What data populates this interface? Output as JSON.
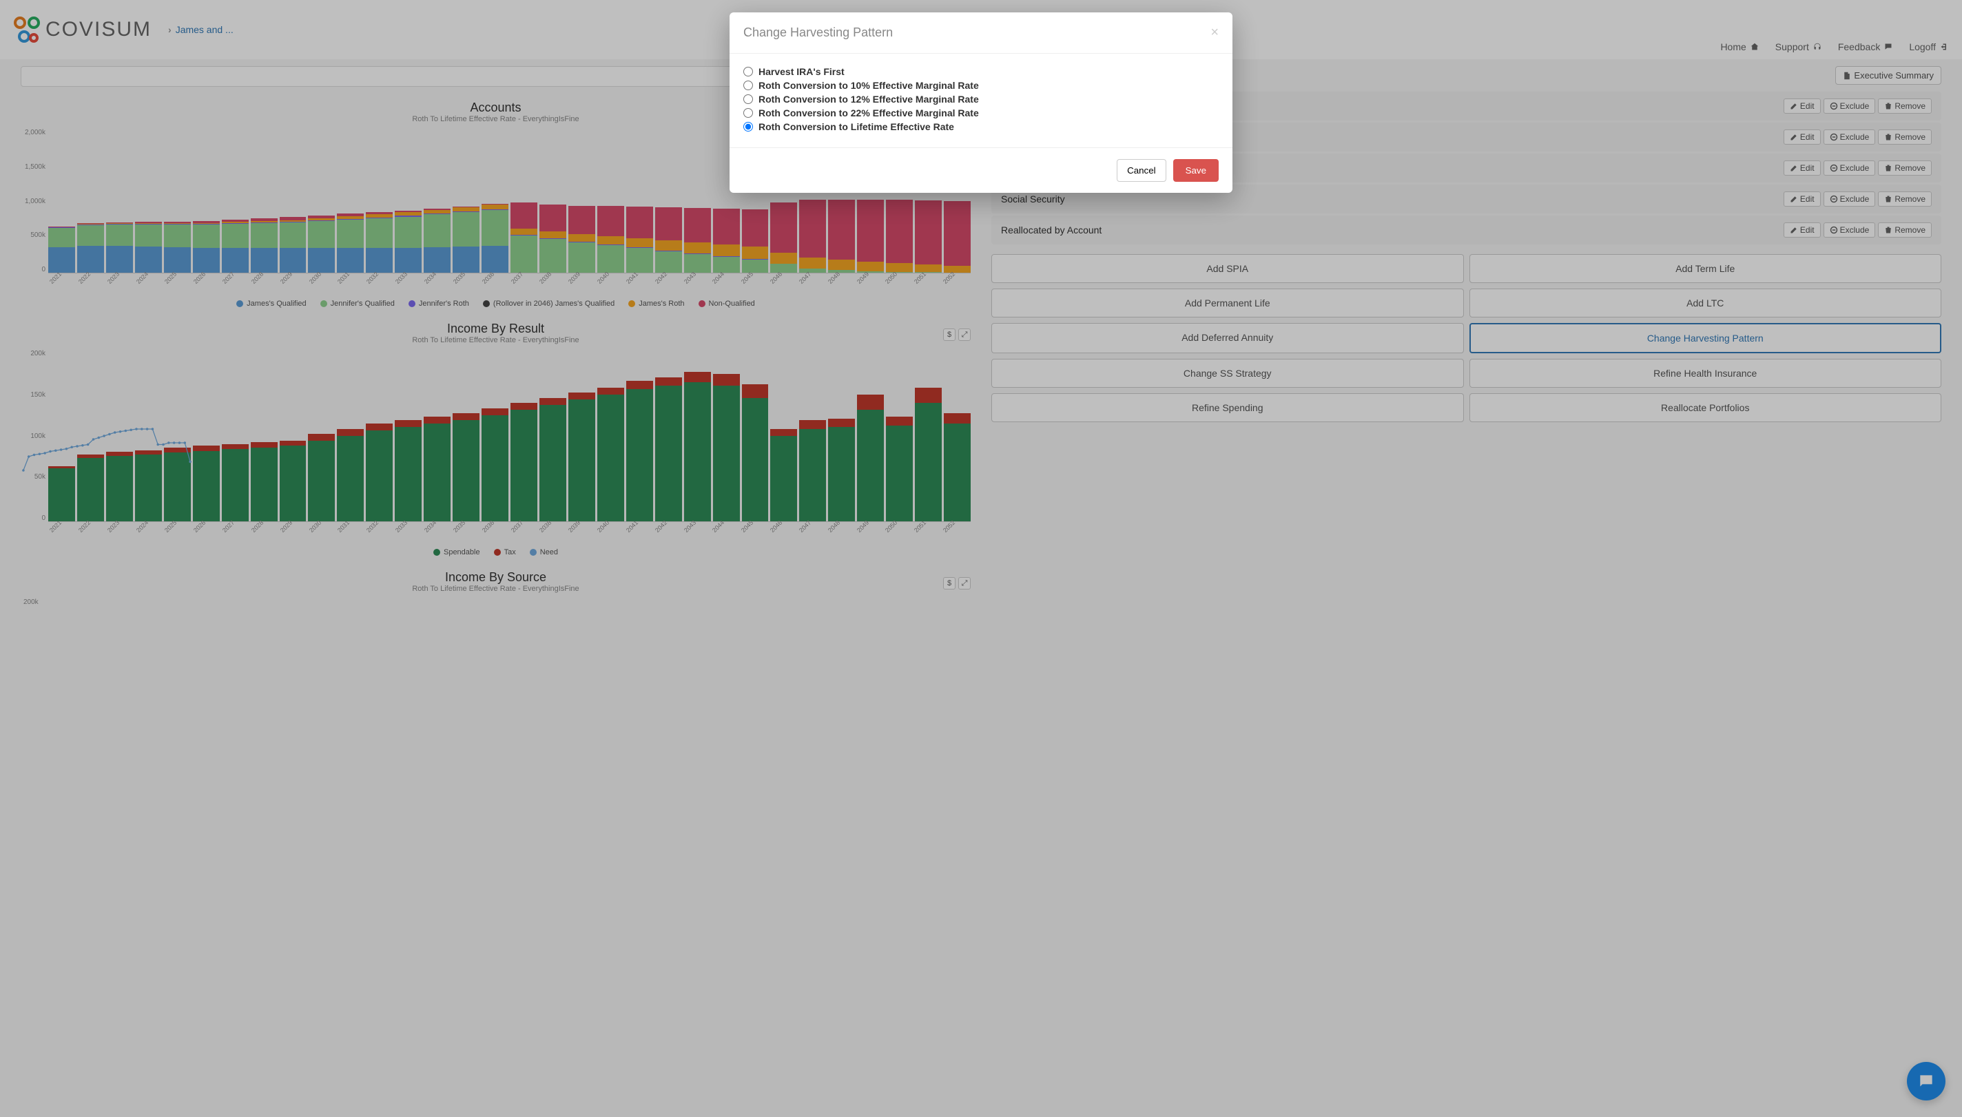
{
  "logo_text": "COVISUM",
  "breadcrumb": "James and ...",
  "nav": {
    "home": "Home",
    "support": "Support",
    "feedback": "Feedback",
    "logoff": "Logoff"
  },
  "exec_summary": "Executive Summary",
  "item_rows": [
    {
      "label": ""
    },
    {
      "label": ""
    },
    {
      "label": ""
    },
    {
      "label": "Social Security"
    },
    {
      "label": "Reallocated by Account"
    }
  ],
  "row_actions": {
    "edit": "Edit",
    "exclude": "Exclude",
    "remove": "Remove"
  },
  "buttons": {
    "add_spia": "Add SPIA",
    "add_term": "Add Term Life",
    "add_perm": "Add Permanent Life",
    "add_ltc": "Add LTC",
    "add_def": "Add Deferred Annuity",
    "change_harvest": "Change Harvesting Pattern",
    "change_ss": "Change SS Strategy",
    "refine_health": "Refine Health Insurance",
    "refine_spend": "Refine Spending",
    "realloc": "Reallocate Portfolios"
  },
  "modal": {
    "title": "Change Harvesting Pattern",
    "options": [
      "Harvest IRA's First",
      "Roth Conversion to 10% Effective Marginal Rate",
      "Roth Conversion to 12% Effective Marginal Rate",
      "Roth Conversion to 22% Effective Marginal Rate",
      "Roth Conversion to Lifetime Effective Rate"
    ],
    "selected": 4,
    "cancel": "Cancel",
    "save": "Save"
  },
  "chart_data": [
    {
      "type": "bar",
      "title": "Accounts",
      "subtitle": "Roth To Lifetime Effective Rate - EverythingIsFine",
      "ylabel": "",
      "ylim": [
        0,
        2000
      ],
      "yticks": [
        "0",
        "500k",
        "1,000k",
        "1,500k",
        "2,000k"
      ],
      "categories": [
        "2021",
        "2022",
        "2023",
        "2024",
        "2025",
        "2026",
        "2027",
        "2028",
        "2029",
        "2030",
        "2031",
        "2032",
        "2033",
        "2034",
        "2035",
        "2036",
        "2037",
        "2038",
        "2039",
        "2040",
        "2041",
        "2042",
        "2043",
        "2044",
        "2045",
        "2046",
        "2047",
        "2048",
        "2049",
        "2050",
        "2051",
        "2052"
      ],
      "series": [
        {
          "name": "James's Qualified",
          "color": "#5b9bd5",
          "values": [
            350,
            370,
            370,
            360,
            350,
            340,
            340,
            340,
            340,
            340,
            340,
            340,
            340,
            350,
            360,
            370,
            0,
            0,
            0,
            0,
            0,
            0,
            0,
            0,
            0,
            0,
            0,
            0,
            0,
            0,
            0,
            0
          ]
        },
        {
          "name": "Jennifer's Qualified",
          "color": "#8fd18f",
          "values": [
            270,
            290,
            300,
            310,
            320,
            330,
            340,
            350,
            360,
            380,
            400,
            420,
            440,
            460,
            480,
            500,
            520,
            470,
            420,
            380,
            340,
            300,
            260,
            220,
            180,
            120,
            60,
            40,
            20,
            10,
            5,
            0
          ]
        },
        {
          "name": "Jennifer's Roth",
          "color": "#7b68ee",
          "values": [
            10,
            10,
            10,
            10,
            10,
            10,
            10,
            10,
            10,
            10,
            10,
            10,
            10,
            10,
            10,
            10,
            10,
            10,
            10,
            10,
            10,
            10,
            10,
            10,
            10,
            0,
            0,
            0,
            0,
            0,
            0,
            0
          ]
        },
        {
          "name": "(Rollover in 2046) James's Qualified",
          "color": "#444",
          "values": [
            0,
            0,
            0,
            0,
            0,
            0,
            0,
            0,
            0,
            0,
            0,
            0,
            0,
            0,
            0,
            0,
            0,
            0,
            0,
            0,
            0,
            0,
            0,
            0,
            0,
            0,
            0,
            0,
            0,
            0,
            0,
            0
          ]
        },
        {
          "name": "James's Roth",
          "color": "#f5a623",
          "values": [
            5,
            6,
            7,
            8,
            10,
            12,
            14,
            18,
            22,
            28,
            34,
            40,
            48,
            56,
            64,
            72,
            82,
            92,
            102,
            114,
            126,
            138,
            150,
            160,
            170,
            160,
            150,
            140,
            130,
            120,
            110,
            100
          ]
        },
        {
          "name": "Non-Qualified",
          "color": "#d64a6a",
          "values": [
            10,
            10,
            15,
            18,
            20,
            25,
            30,
            35,
            40,
            40,
            35,
            30,
            20,
            10,
            5,
            5,
            360,
            380,
            400,
            420,
            440,
            460,
            480,
            500,
            520,
            700,
            800,
            830,
            860,
            880,
            890,
            900
          ]
        }
      ]
    },
    {
      "type": "bar",
      "title": "Income By Result",
      "subtitle": "Roth To Lifetime Effective Rate - EverythingIsFine",
      "ylabel": "",
      "ylim": [
        0,
        200
      ],
      "yticks": [
        "0",
        "50k",
        "100k",
        "150k",
        "200k"
      ],
      "tools": [
        "$",
        "expand"
      ],
      "categories": [
        "2021",
        "2022",
        "2023",
        "2024",
        "2025",
        "2026",
        "2027",
        "2028",
        "2029",
        "2030",
        "2031",
        "2032",
        "2033",
        "2034",
        "2035",
        "2036",
        "2037",
        "2038",
        "2039",
        "2040",
        "2041",
        "2042",
        "2043",
        "2044",
        "2045",
        "2046",
        "2047",
        "2048",
        "2049",
        "2050",
        "2051",
        "2052"
      ],
      "series": [
        {
          "name": "Spendable",
          "color": "#2e8b57",
          "values": [
            62,
            74,
            76,
            78,
            80,
            82,
            84,
            86,
            88,
            94,
            100,
            106,
            110,
            114,
            118,
            124,
            130,
            136,
            142,
            148,
            154,
            158,
            162,
            158,
            144,
            100,
            108,
            110,
            130,
            112,
            138,
            114
          ]
        },
        {
          "name": "Tax",
          "color": "#c0392b",
          "values": [
            2,
            4,
            5,
            5,
            6,
            6,
            6,
            6,
            6,
            8,
            8,
            8,
            8,
            8,
            8,
            8,
            8,
            8,
            8,
            8,
            10,
            10,
            12,
            14,
            16,
            8,
            10,
            10,
            18,
            10,
            18,
            12
          ]
        }
      ],
      "line": {
        "name": "Need",
        "color": "#6fa8dc",
        "values": [
          60,
          76,
          78,
          79,
          80,
          82,
          83,
          84,
          85,
          87,
          88,
          89,
          90,
          96,
          98,
          100,
          102,
          104,
          105,
          106,
          107,
          108,
          108,
          108,
          108,
          90,
          90,
          92,
          92,
          92,
          92,
          70
        ]
      }
    },
    {
      "type": "bar",
      "title": "Income By Source",
      "subtitle": "Roth To Lifetime Effective Rate - EverythingIsFine",
      "tools": [
        "$",
        "expand"
      ],
      "yticks": [
        "200k"
      ]
    }
  ]
}
